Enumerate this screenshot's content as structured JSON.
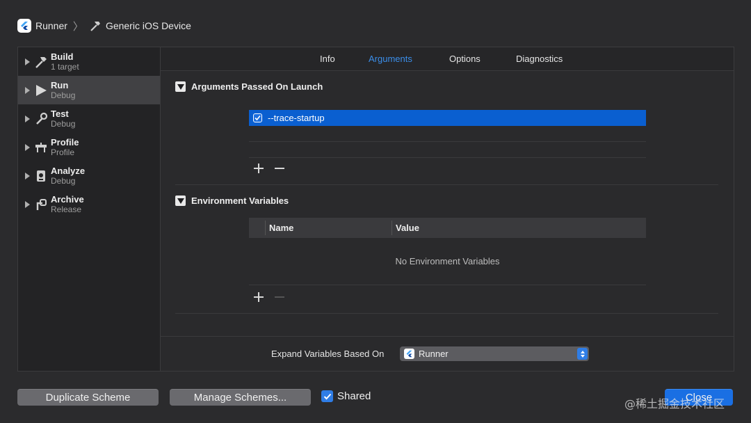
{
  "breadcrumb": {
    "project": "Runner",
    "destination": "Generic iOS Device"
  },
  "sidebar": {
    "items": [
      {
        "title": "Build",
        "subtitle": "1 target",
        "icon": "hammer-icon"
      },
      {
        "title": "Run",
        "subtitle": "Debug",
        "icon": "play-icon"
      },
      {
        "title": "Test",
        "subtitle": "Debug",
        "icon": "wrench-icon"
      },
      {
        "title": "Profile",
        "subtitle": "Profile",
        "icon": "gauge-icon"
      },
      {
        "title": "Analyze",
        "subtitle": "Debug",
        "icon": "analyze-icon"
      },
      {
        "title": "Archive",
        "subtitle": "Release",
        "icon": "archive-icon"
      }
    ],
    "selected_index": 1
  },
  "tabs": [
    {
      "label": "Info",
      "active": false
    },
    {
      "label": "Arguments",
      "active": true
    },
    {
      "label": "Options",
      "active": false
    },
    {
      "label": "Diagnostics",
      "active": false
    }
  ],
  "arguments": {
    "heading": "Arguments Passed On Launch",
    "items": [
      {
        "value": "--trace-startup",
        "checked": true
      }
    ]
  },
  "environment": {
    "heading": "Environment Variables",
    "col_name": "Name",
    "col_value": "Value",
    "empty_text": "No Environment Variables"
  },
  "expand": {
    "label": "Expand Variables Based On",
    "selected": "Runner"
  },
  "footer": {
    "duplicate_label": "Duplicate Scheme",
    "manage_label": "Manage Schemes...",
    "shared_label": "Shared",
    "shared_checked": true,
    "close_label": "Close",
    "watermark": "@稀土掘金技术社区"
  },
  "colors": {
    "accent": "#2f7de6",
    "selection": "#0a5fd0",
    "active_tab": "#3b8eea"
  }
}
